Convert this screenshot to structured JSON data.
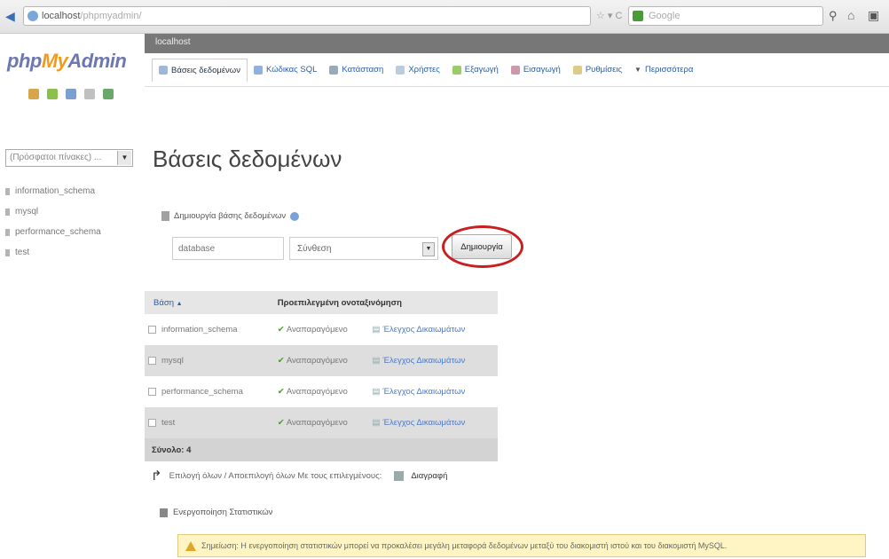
{
  "browser": {
    "url_host": "localhost",
    "url_path": "/phpmyadmin/",
    "search_placeholder": "Google"
  },
  "sidebar": {
    "logo_php": "php",
    "logo_my": "My",
    "logo_admin": "Admin",
    "recent_placeholder": "(Πρόσφατοι πίνακες) ...",
    "databases": [
      "information_schema",
      "mysql",
      "performance_schema",
      "test"
    ]
  },
  "server_bar": {
    "label": "localhost"
  },
  "tabs": [
    {
      "label": "Βάσεις δεδομένων",
      "icon": "database-icon",
      "active": true
    },
    {
      "label": "Κώδικας SQL",
      "icon": "sql-icon"
    },
    {
      "label": "Κατάσταση",
      "icon": "status-icon"
    },
    {
      "label": "Χρήστες",
      "icon": "users-icon"
    },
    {
      "label": "Εξαγωγή",
      "icon": "export-icon"
    },
    {
      "label": "Εισαγωγή",
      "icon": "import-icon"
    },
    {
      "label": "Ρυθμίσεις",
      "icon": "settings-icon"
    },
    {
      "label": "Περισσότερα",
      "icon": "more-icon"
    }
  ],
  "main": {
    "title": "Βάσεις δεδομένων",
    "create_label": "Δημιουργία βάσης δεδομένων",
    "db_name_placeholder": "database",
    "collation_value": "Σύνθεση",
    "create_button": "Δημιουργία"
  },
  "table": {
    "header_db": "Βάση",
    "header_sort": "▲",
    "header_collation": "Προεπιλεγμένη ονοταξινόμηση",
    "rows": [
      {
        "name": "information_schema",
        "replication": "Αναπαραγόμενο",
        "privileges": "Έλεγχος Δικαιωμάτων"
      },
      {
        "name": "mysql",
        "replication": "Αναπαραγόμενο",
        "privileges": "Έλεγχος Δικαιωμάτων"
      },
      {
        "name": "performance_schema",
        "replication": "Αναπαραγόμενο",
        "privileges": "Έλεγχος Δικαιωμάτων"
      },
      {
        "name": "test",
        "replication": "Αναπαραγόμενο",
        "privileges": "Έλεγχος Δικαιωμάτων"
      }
    ],
    "total_label": "Σύνολο: 4"
  },
  "bulk": {
    "text": "Επιλογή όλων / Αποεπιλογή όλων Με τους επιλεγμένους:",
    "drop_button": "Διαγραφή"
  },
  "stats": {
    "label": "Ενεργοποίηση Στατιστικών"
  },
  "notice": {
    "text": "Σημείωση: Η ενεργοποίηση στατιστικών μπορεί να προκαλέσει μεγάλη μεταφορά δεδομένων μεταξύ του διακομιστή ιστού και του διακομιστή MySQL."
  }
}
